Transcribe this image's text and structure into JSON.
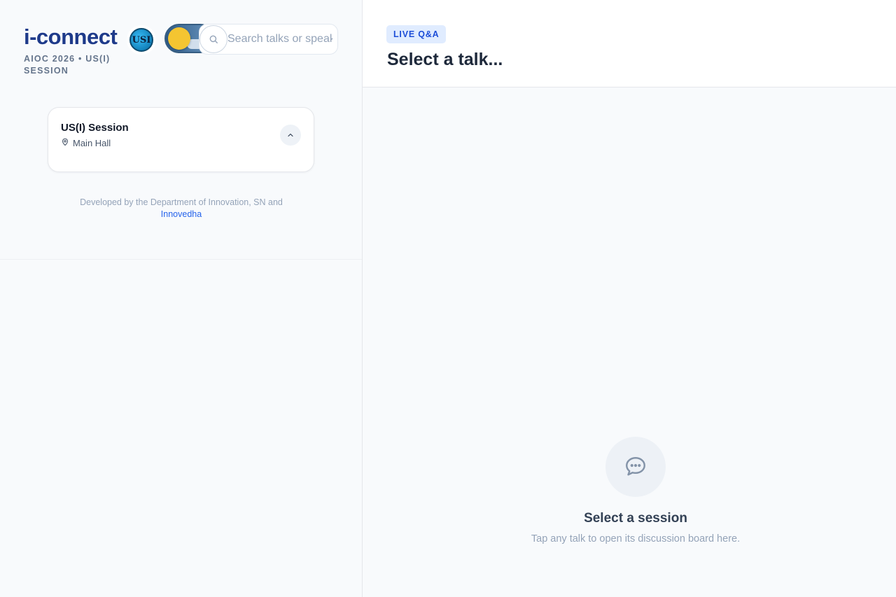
{
  "brand": {
    "name": "i-connect",
    "subtitle": "AIOC 2026 • US(I) SESSION",
    "logo_text": "USI"
  },
  "search": {
    "placeholder": "Search talks or speakers"
  },
  "session_card": {
    "title": "US(I) Session",
    "location": "Main Hall",
    "expanded": true
  },
  "footer": {
    "credit_prefix": "Developed by the Department of Innovation, SN and",
    "credit_link": "Innovedha"
  },
  "main": {
    "badge": "LIVE Q&A",
    "title": "Select a talk...",
    "empty_title": "Select a session",
    "empty_desc": "Tap any talk to open its discussion board here."
  },
  "colors": {
    "brand": "#1e3a8a",
    "accent": "#2563eb",
    "badge_bg": "#e0ecff",
    "toggle_knob": "#f4c531"
  },
  "icons": {
    "search": "search-icon",
    "location": "map-pin-icon",
    "collapse": "chevron-up-icon",
    "empty": "chat-bubble-icon",
    "theme": "sun-icon"
  }
}
